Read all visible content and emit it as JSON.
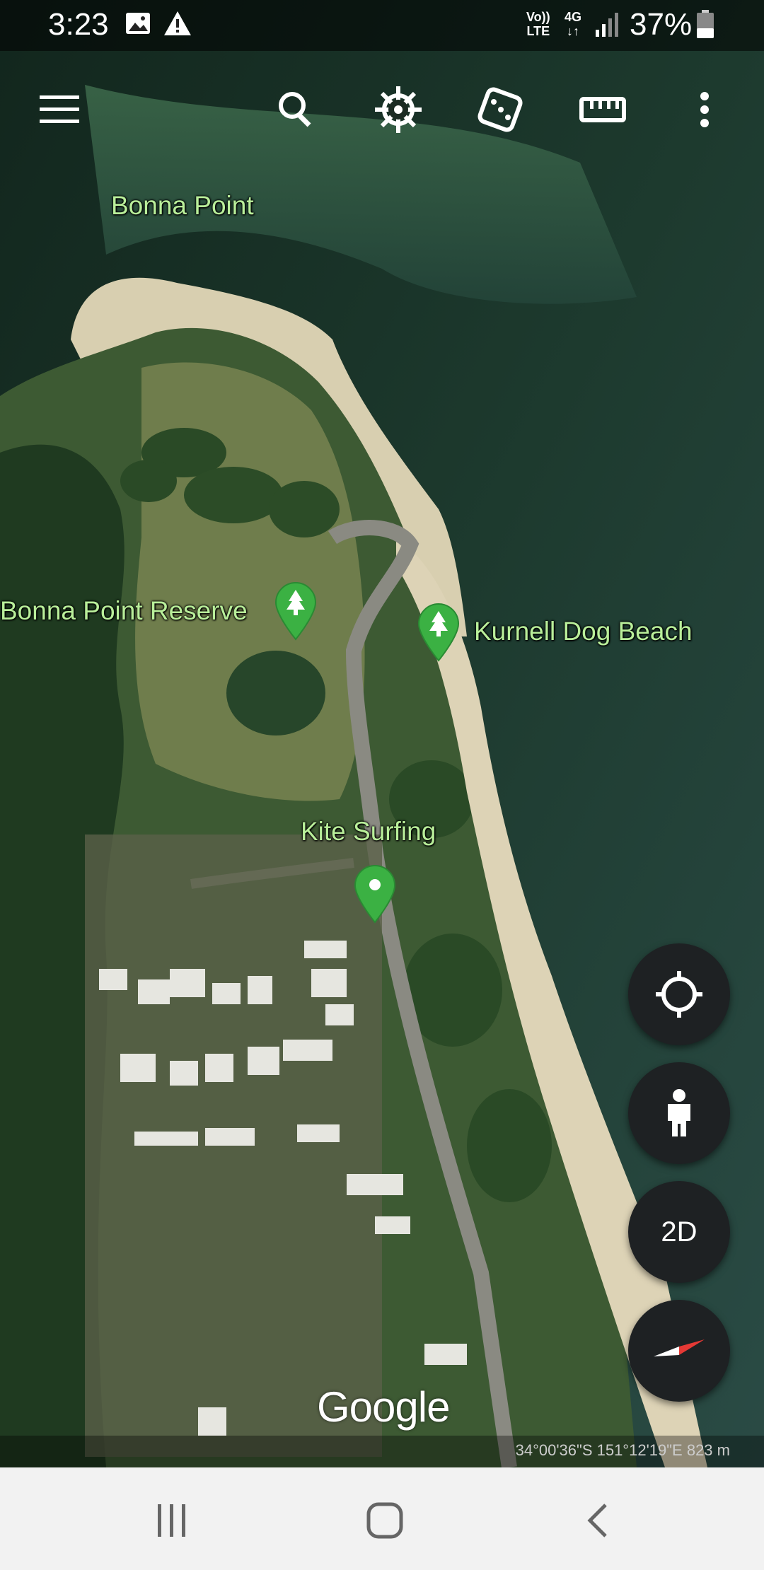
{
  "status_bar": {
    "time": "3:23",
    "net_top": "Vo))",
    "net_bottom": "LTE",
    "net_type": "4G",
    "battery": "37%",
    "icons": [
      "image-icon",
      "warning-icon",
      "signal-icon",
      "battery-icon"
    ]
  },
  "toolbar": {
    "icons": [
      "menu-icon",
      "search-icon",
      "voyager-icon",
      "dice-icon",
      "ruler-icon",
      "more-icon"
    ]
  },
  "map": {
    "labels": {
      "bonna_point": "Bonna Point",
      "bonna_point_reserve": "Bonna Point Reserve",
      "kurnell_dog_beach": "Kurnell Dog Beach",
      "kite_surfing": "Kite Surfing"
    },
    "pin_colors": {
      "park": "#3bb143",
      "place": "#3bb143"
    },
    "attribution": "Google",
    "coordinates": "34°00'36\"S 151°12'19\"E 823 m"
  },
  "controls": {
    "view_mode": "2D",
    "icons": [
      "my-location-icon",
      "pegman-icon",
      "compass-icon"
    ]
  },
  "nav_bar": {
    "icons": [
      "recent-apps-icon",
      "home-icon",
      "back-icon"
    ]
  }
}
